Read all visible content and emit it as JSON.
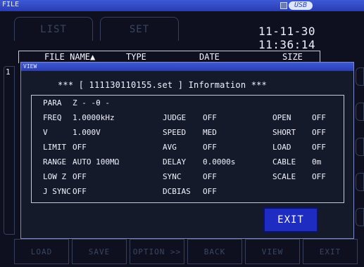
{
  "window": {
    "title": "FILE",
    "usb_label": "USB"
  },
  "tabs": [
    {
      "label": "LIST"
    },
    {
      "label": "SET"
    }
  ],
  "clock": "11-11-30 11:36:14",
  "file_header": {
    "name": "FILE NAME▲",
    "type": "TYPE",
    "date": "DATE",
    "size": "SIZE"
  },
  "left_marker": "1",
  "dialog": {
    "title": "VIEW",
    "info_line": "*** [ 111130110155.set ] Information ***",
    "rows": [
      [
        {
          "k": "PARA",
          "v": "Z - -θ -"
        },
        {
          "k": "",
          "v": ""
        },
        {
          "k": "",
          "v": ""
        }
      ],
      [
        {
          "k": "FREQ",
          "v": "1.0000kHz"
        },
        {
          "k": "JUDGE",
          "v": "OFF"
        },
        {
          "k": "OPEN",
          "v": "OFF"
        }
      ],
      [
        {
          "k": "V",
          "v": "1.000V"
        },
        {
          "k": "SPEED",
          "v": "MED"
        },
        {
          "k": "SHORT",
          "v": "OFF"
        }
      ],
      [
        {
          "k": "LIMIT",
          "v": "OFF"
        },
        {
          "k": "AVG",
          "v": "OFF"
        },
        {
          "k": "LOAD",
          "v": "OFF"
        }
      ],
      [
        {
          "k": "RANGE",
          "v": "AUTO 100MΩ"
        },
        {
          "k": "DELAY",
          "v": "0.0000s"
        },
        {
          "k": "CABLE",
          "v": "0m"
        }
      ],
      [
        {
          "k": "LOW Z",
          "v": "OFF"
        },
        {
          "k": "SYNC",
          "v": "OFF"
        },
        {
          "k": "SCALE",
          "v": "OFF"
        }
      ],
      [
        {
          "k": "J SYNC",
          "v": "OFF"
        },
        {
          "k": "DCBIAS",
          "v": "OFF"
        },
        {
          "k": "",
          "v": ""
        }
      ]
    ],
    "exit_label": "EXIT"
  },
  "bottom_buttons": [
    {
      "label": "LOAD"
    },
    {
      "label": "SAVE"
    },
    {
      "label": "OPTION >>"
    },
    {
      "label": "BACK"
    },
    {
      "label": "VIEW"
    },
    {
      "label": "EXIT"
    }
  ],
  "colors": {
    "title_bar": "#2a3db3",
    "exit_button": "#1f2cc2",
    "background": "#0e1020"
  }
}
